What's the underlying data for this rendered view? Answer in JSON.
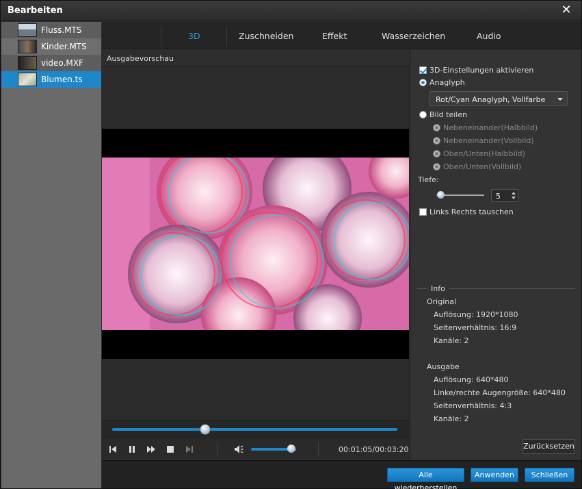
{
  "window": {
    "title": "Bearbeiten"
  },
  "files": [
    {
      "name": "Fluss.MTS"
    },
    {
      "name": "Kinder.MTS"
    },
    {
      "name": "video.MXF"
    },
    {
      "name": "Blumen.ts"
    }
  ],
  "tabs": [
    "3D",
    "Zuschneiden",
    "Effekt",
    "Wasserzeichen",
    "Audio"
  ],
  "preview": {
    "label": "Ausgabevorschau"
  },
  "player": {
    "time": "00:01:05/00:03:20",
    "progress": 0.325,
    "volume": 0.9
  },
  "settings": {
    "enable_3d": "3D-Einstellungen aktivieren",
    "anaglyph": "Anaglyph",
    "anaglyph_mode": "Rot/Cyan Anaglyph, Vollfarbe",
    "split": "Bild teilen",
    "split_options": [
      "Nebeneinander(Halbbild)",
      "Nebeneinander(Vollbild)",
      "Oben/Unten(Halbbild)",
      "Oben/Unten(Vollbild)"
    ],
    "depth_label": "Tiefe:",
    "depth_value": "5",
    "swap": "Links Rechts tauschen"
  },
  "info": {
    "title": "Info",
    "original_label": "Original",
    "original": [
      "Auflösung: 1920*1080",
      "Seitenverhältnis: 16:9",
      "Kanäle: 2"
    ],
    "output_label": "Ausgabe",
    "output": [
      "Auflösung: 640*480",
      "Linke/rechte Augengröße: 640*480",
      "Seitenverhältnis: 4:3",
      "Kanäle: 2"
    ]
  },
  "buttons": {
    "reset": "Zurücksetzen",
    "restore_all": "Alle wiederherstellen",
    "apply": "Anwenden",
    "close": "Schließen"
  },
  "colors": {
    "accent": "#1f86c9",
    "active_tab": "#2b9be0"
  }
}
